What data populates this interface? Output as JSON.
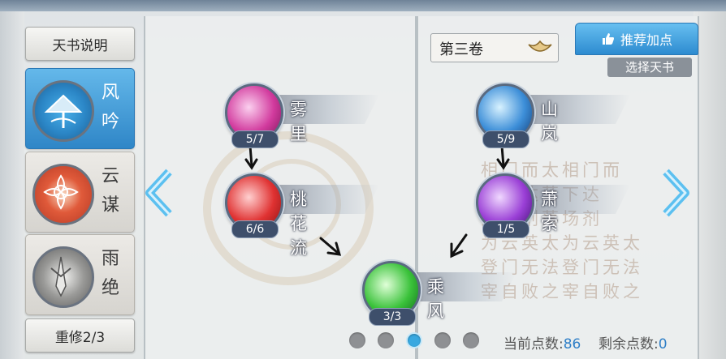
{
  "sidebar": {
    "help_button": "天书说明",
    "tabs": [
      {
        "label_1": "风",
        "label_2": "吟",
        "active": true
      },
      {
        "label_1": "云",
        "label_2": "谋",
        "active": false
      },
      {
        "label_1": "雨",
        "label_2": "绝",
        "active": false
      }
    ],
    "rebuild_button": "重修2/3"
  },
  "header": {
    "volume_label": "第三卷",
    "recommend_button": "推荐加点",
    "select_book_button": "选择天书"
  },
  "skills": {
    "wuli": {
      "name": "雾里",
      "count": "5/7"
    },
    "taohualiu": {
      "name": "桃花流",
      "count": "6/6"
    },
    "shanlan": {
      "name": "山岚",
      "count": "5/9"
    },
    "xiaosuo": {
      "name": "萧索",
      "count": "1/5"
    },
    "chengfeng": {
      "name": "乘风",
      "count": "3/3"
    }
  },
  "background_text": [
    "相门而太相门而",
    "落下达落下达",
    "落场剂落场剂",
    "为云英太为云英太",
    "登门无法登门无法",
    "宰自败之宰自败之"
  ],
  "pagination": {
    "pages": 5,
    "active_index": 2
  },
  "points": {
    "current_label": "当前点数:",
    "current_value": "86",
    "remaining_label": "剩余点数:",
    "remaining_value": "0"
  },
  "colors": {
    "accent_blue": "#2f86c7",
    "number_blue": "#2f7fc7"
  }
}
